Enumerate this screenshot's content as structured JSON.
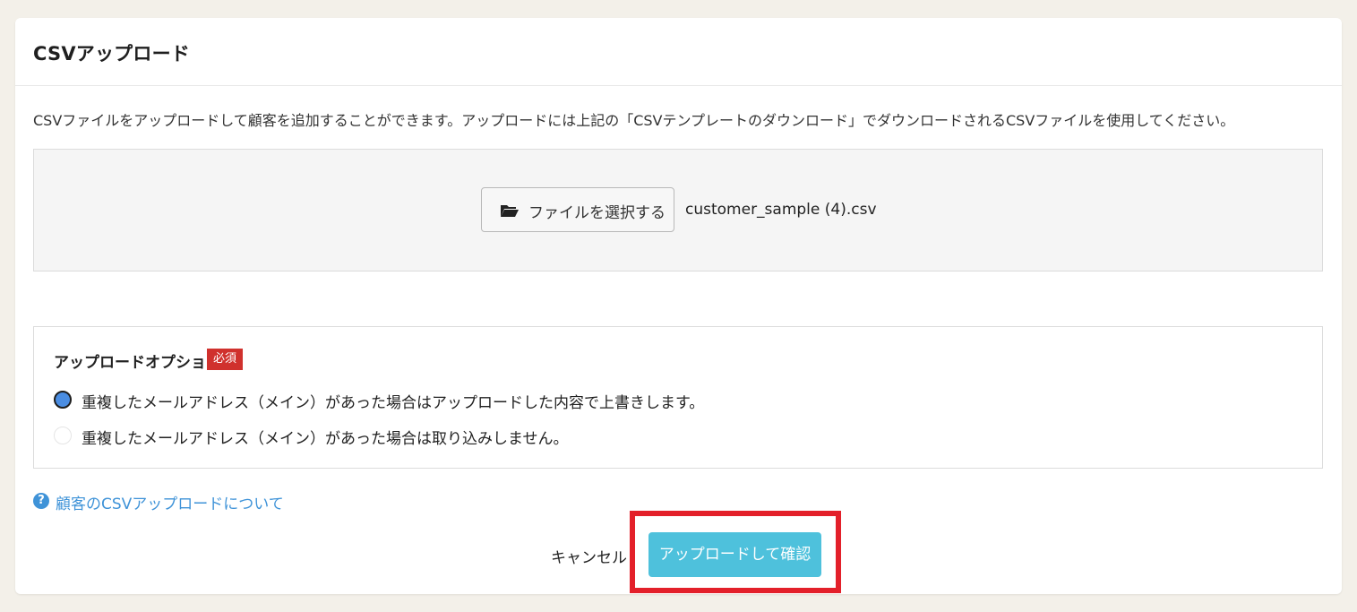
{
  "card": {
    "title": "CSVアップロード",
    "description": "CSVファイルをアップロードして顧客を追加することができます。アップロードには上記の「CSVテンプレートのダウンロード」でダウンロードされるCSVファイルを使用してください。"
  },
  "upload": {
    "file_button_label": "ファイルを選択する",
    "file_button_icon": "folder-open-icon",
    "selected_file_name": "customer_sample (4).csv"
  },
  "options": {
    "title": "アップロードオプション",
    "required_badge": "必須",
    "items": [
      {
        "label": "重複したメールアドレス（メイン）があった場合はアップロードした内容で上書きします。",
        "checked": true
      },
      {
        "label": "重複したメールアドレス（メイン）があった場合は取り込みしません。",
        "checked": false
      }
    ]
  },
  "help": {
    "icon": "question-circle-icon",
    "icon_glyph": "?",
    "link_text": "顧客のCSVアップロードについて"
  },
  "actions": {
    "cancel_label": "キャンセル",
    "submit_label": "アップロードして確認"
  },
  "colors": {
    "accent": "#4ec1dc",
    "link": "#3f93d8",
    "required": "#d0312d",
    "highlight": "#e3202a",
    "background": "#f3f0e9"
  }
}
